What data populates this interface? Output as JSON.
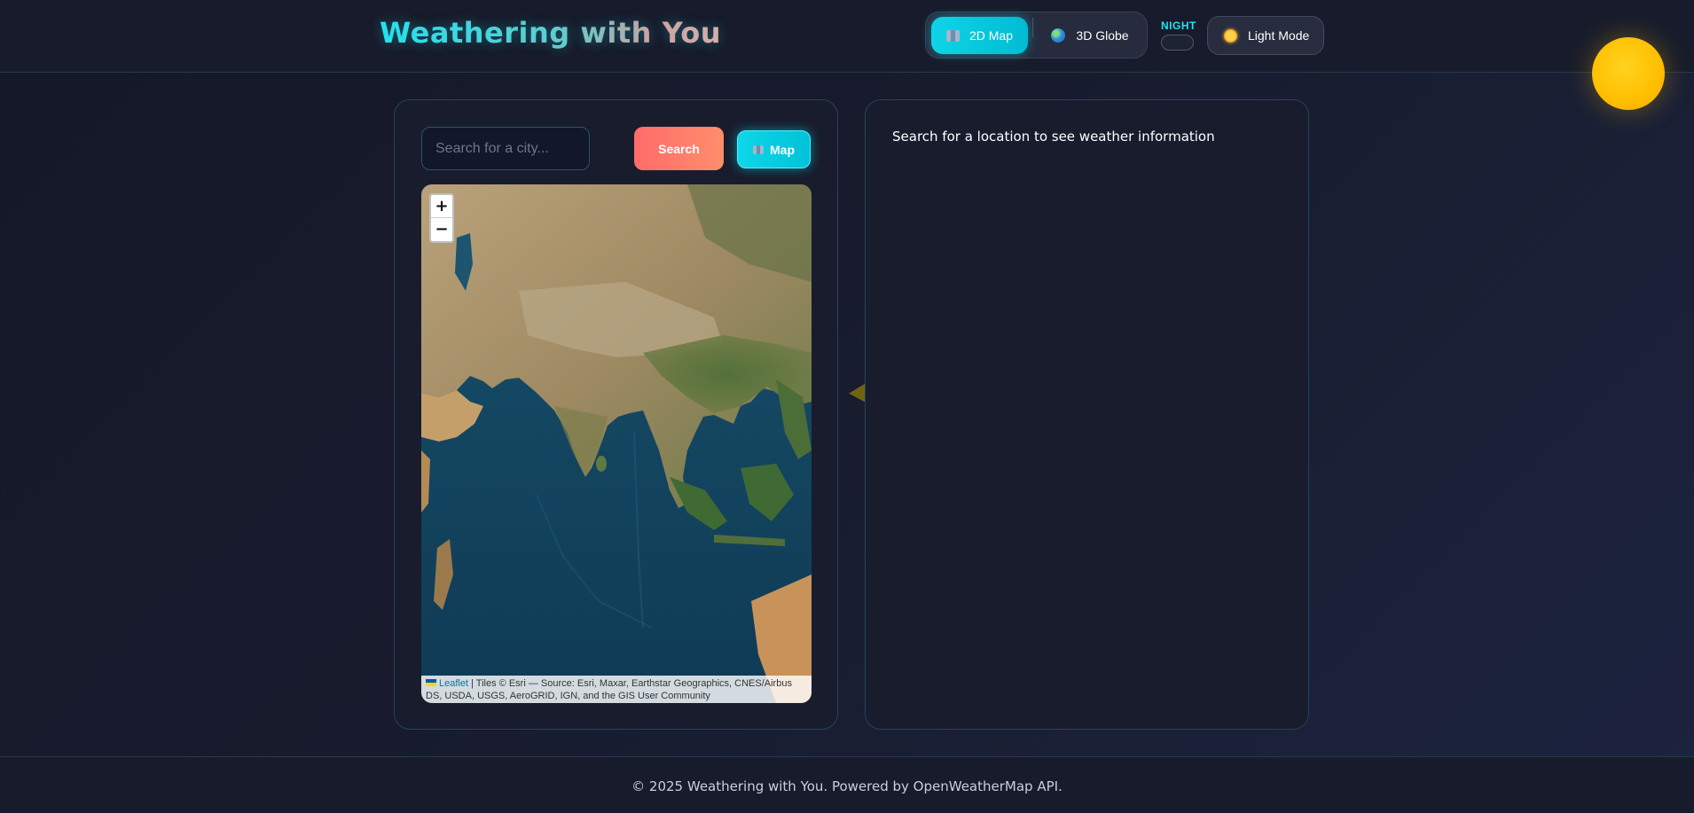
{
  "header": {
    "logo": "Weathering with You",
    "view_toggle": {
      "active": "2D Map",
      "inactive": "3D Globe"
    },
    "night_label": "NIGHT",
    "theme_button": "Light Mode"
  },
  "search": {
    "placeholder": "Search for a city...",
    "value": "",
    "search_button": "Search",
    "map_button": "Map"
  },
  "map": {
    "zoom_in": "+",
    "zoom_out": "−",
    "attribution_link": "Leaflet",
    "attribution_text": " | Tiles © Esri — Source: Esri, Maxar, Earthstar Geographics, CNES/Airbus DS, USDA, USGS, AeroGRID, IGN, and the GIS User Community"
  },
  "weather_panel": {
    "message": "Search for a location to see weather information"
  },
  "footer": {
    "text": "© 2025 Weathering with You. Powered by OpenWeatherMap API."
  },
  "colors": {
    "accent_cyan": "#22e3ee",
    "accent_coral": "#ff6b6b",
    "background": "#171b2b",
    "sun": "#ffbf00"
  },
  "icons": {
    "map_toggle": "map-icon",
    "globe_toggle": "globe-icon",
    "theme": "sun-icon"
  }
}
